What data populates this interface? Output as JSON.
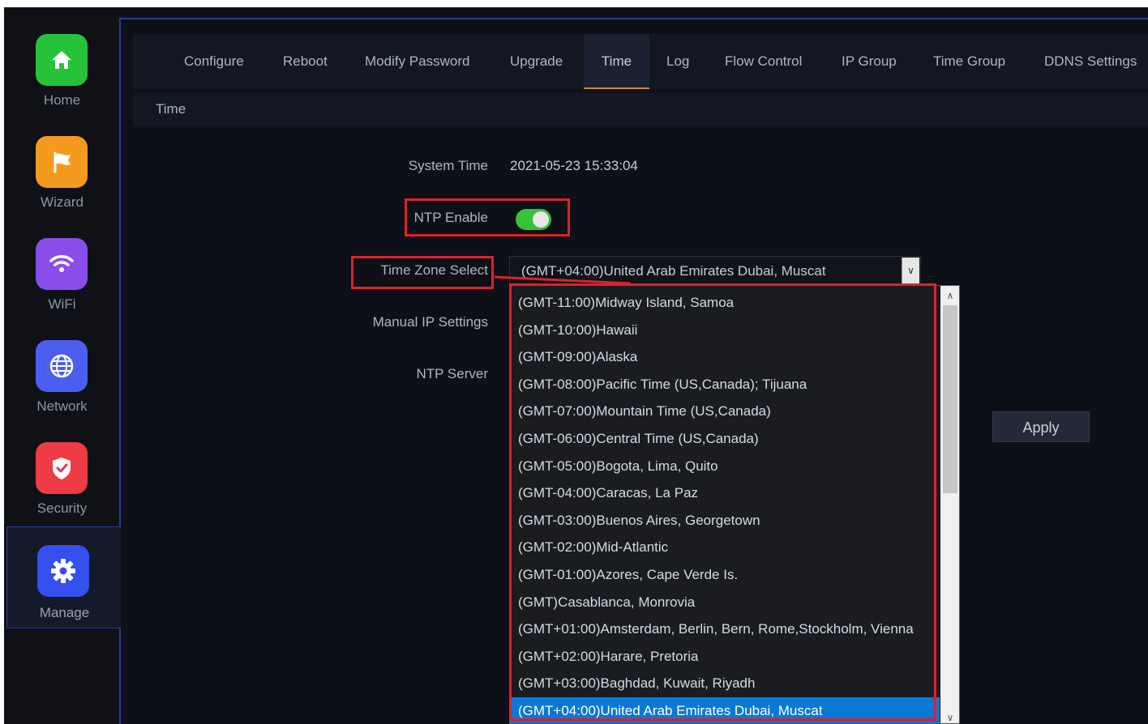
{
  "sidebar": {
    "items": [
      {
        "label": "Home",
        "color": "#27c23a",
        "icon": "home-icon"
      },
      {
        "label": "Wizard",
        "color": "#f59a1e",
        "icon": "flag-icon"
      },
      {
        "label": "WiFi",
        "color": "#8b4dea",
        "icon": "wifi-icon"
      },
      {
        "label": "Network",
        "color": "#4a5ff0",
        "icon": "globe-icon"
      },
      {
        "label": "Security",
        "color": "#ee3b46",
        "icon": "shield-icon"
      },
      {
        "label": "Manage",
        "color": "#3550ef",
        "icon": "gear-icon"
      }
    ],
    "active": "Manage"
  },
  "tabs": [
    "Configure",
    "Reboot",
    "Modify Password",
    "Upgrade",
    "Time",
    "Log",
    "Flow Control",
    "IP Group",
    "Time Group",
    "DDNS Settings"
  ],
  "active_tab": "Time",
  "section_title": "Time",
  "form": {
    "system_time_label": "System Time",
    "system_time_value": "2021-05-23 15:33:04",
    "ntp_enable_label": "NTP Enable",
    "ntp_enabled": true,
    "timezone_label": "Time Zone Select",
    "timezone_value": "(GMT+04:00)United Arab Emirates Dubai, Muscat",
    "manual_ip_label": "Manual IP Settings",
    "ntp_server_label": "NTP Server"
  },
  "dropdown_options": [
    "(GMT-11:00)Midway Island, Samoa",
    "(GMT-10:00)Hawaii",
    "(GMT-09:00)Alaska",
    "(GMT-08:00)Pacific Time (US,Canada); Tijuana",
    "(GMT-07:00)Mountain Time (US,Canada)",
    "(GMT-06:00)Central Time (US,Canada)",
    "(GMT-05:00)Bogota, Lima, Quito",
    "(GMT-04:00)Caracas, La Paz",
    "(GMT-03:00)Buenos Aires, Georgetown",
    "(GMT-02:00)Mid-Atlantic",
    "(GMT-01:00)Azores, Cape Verde Is.",
    "(GMT)Casablanca, Monrovia",
    "(GMT+01:00)Amsterdam, Berlin, Bern, Rome,Stockholm, Vienna",
    "(GMT+02:00)Harare, Pretoria",
    "(GMT+03:00)Baghdad, Kuwait, Riyadh",
    "(GMT+04:00)United Arab Emirates Dubai, Muscat"
  ],
  "selected_option_index": 15,
  "apply_label": "Apply",
  "colors": {
    "accent_tab": "#d4862a",
    "highlight_red": "#e0202a",
    "selected_blue": "#0a78d7",
    "toggle_green": "#38c23a"
  }
}
